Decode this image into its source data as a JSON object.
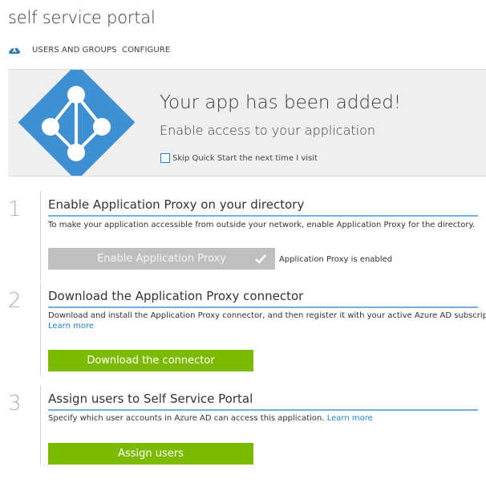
{
  "app": {
    "title": "self service portal"
  },
  "nav": {
    "items": [
      "USERS AND GROUPS",
      "CONFIGURE"
    ],
    "icon": "cloud-app-icon"
  },
  "banner": {
    "heading": "Your app has been added!",
    "subheading": "Enable access to your application",
    "skip_label": "Skip Quick Start the next time I visit",
    "skip_checked": false,
    "logo_color": "#3f8fd3",
    "icon": "app-network-logo"
  },
  "steps": [
    {
      "number": "1",
      "title": "Enable Application Proxy on your directory",
      "description": "To make your application accessible from outside your network, enable Application Proxy for the directory.",
      "button": "Enable Application Proxy",
      "button_enabled": false,
      "status": "Application Proxy is enabled"
    },
    {
      "number": "2",
      "title": "Download the Application Proxy connector",
      "description": "Download and install the Application Proxy connector, and then register it with your active Azure AD subscription.",
      "link": "Learn more",
      "button": "Download the connector"
    },
    {
      "number": "3",
      "title": "Assign users to Self Service Portal",
      "description": "Specify which user accounts in Azure AD can access this application.",
      "link": "Learn more",
      "button": "Assign users"
    }
  ],
  "colors": {
    "accent": "#7cba00",
    "link": "#1f83c6",
    "underline": "#6fb1df",
    "disabled": "#bfbfbf"
  }
}
